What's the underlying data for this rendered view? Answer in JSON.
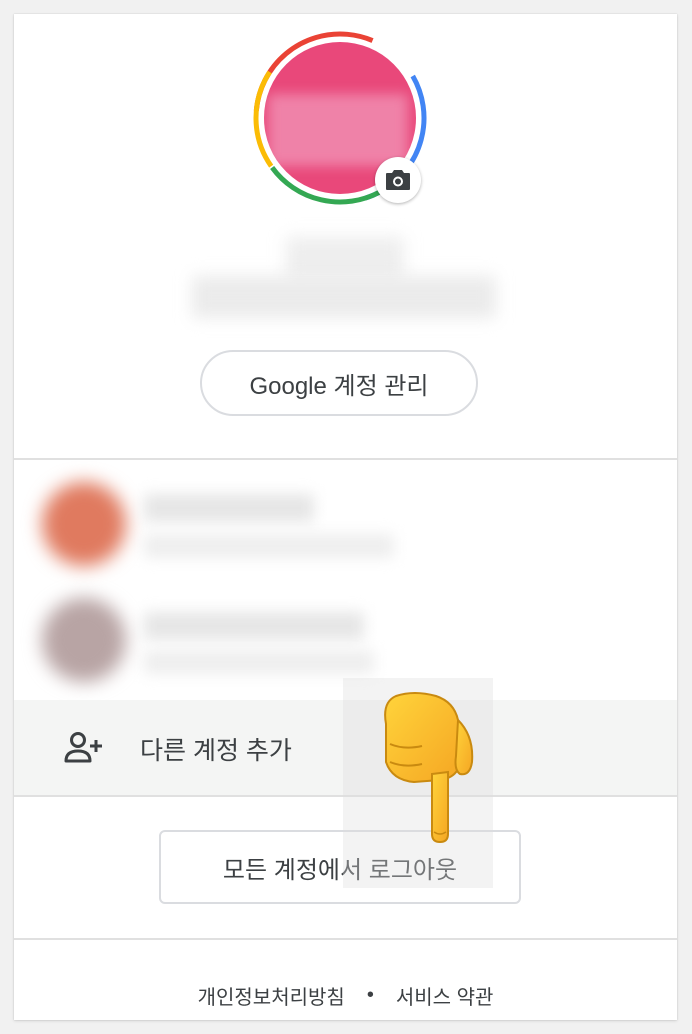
{
  "profile": {
    "manage_account_label": "Google 계정 관리"
  },
  "accounts": {
    "add_account_label": "다른 계정 추가",
    "sign_out_all_label": "모든 계정에서 로그아웃"
  },
  "footer": {
    "privacy_label": "개인정보처리방침",
    "separator": "•",
    "terms_label": "서비스 약관"
  },
  "icons": {
    "camera": "camera-icon",
    "add_person": "person-add-icon",
    "pointer": "pointing-hand-icon"
  },
  "colors": {
    "avatar": "#e9487a",
    "ring_red": "#ea4335",
    "ring_blue": "#4285f4",
    "ring_green": "#34a853",
    "ring_yellow": "#fbbc05"
  }
}
